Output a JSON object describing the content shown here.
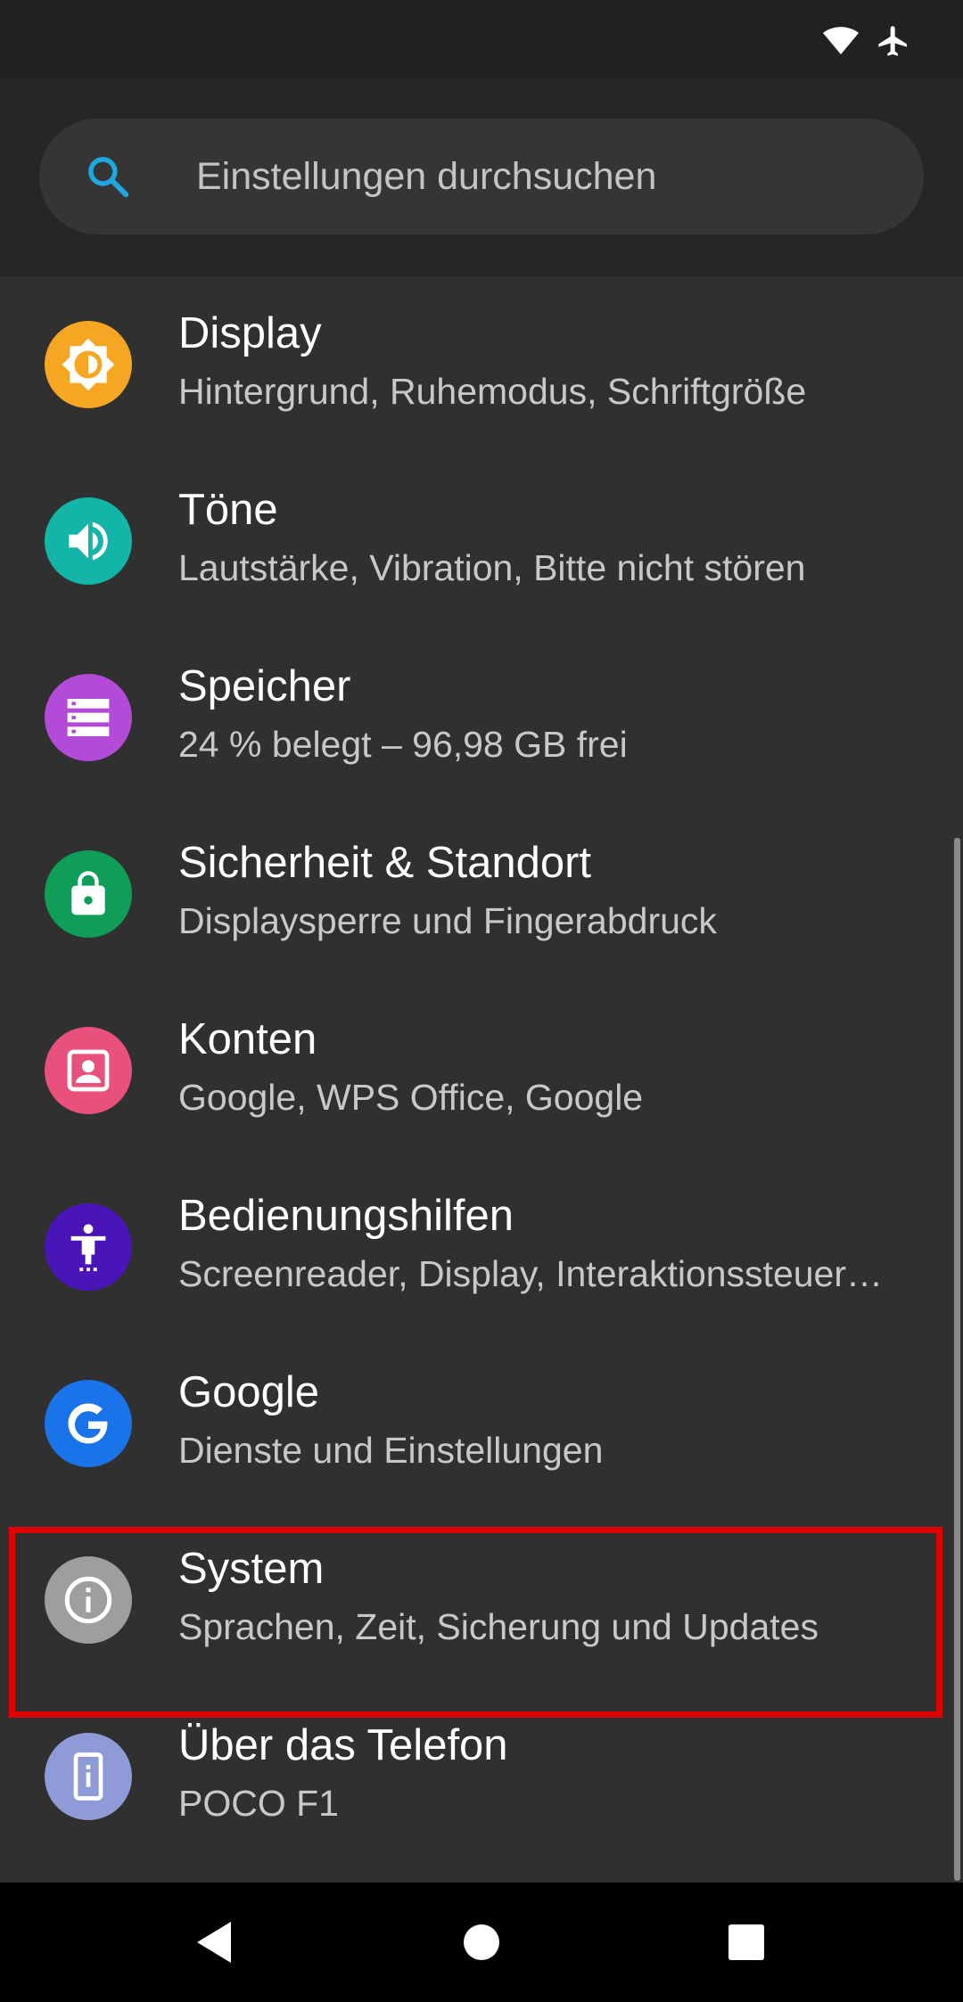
{
  "status_bar": {
    "icons": [
      "wifi-icon",
      "airplane-mode-icon"
    ]
  },
  "search": {
    "placeholder": "Einstellungen durchsuchen",
    "icon": "search-icon",
    "accent_color": "#1fa8e0"
  },
  "settings": [
    {
      "id": "display",
      "title": "Display",
      "subtitle": "Hintergrund, Ruhemodus, Schriftgröße",
      "icon": "brightness-icon",
      "color": "#f5a623"
    },
    {
      "id": "sound",
      "title": "Töne",
      "subtitle": "Lautstärke, Vibration, Bitte nicht stören",
      "icon": "volume-icon",
      "color": "#12b5a7"
    },
    {
      "id": "storage",
      "title": "Speicher",
      "subtitle": "24 % belegt – 96,98 GB frei",
      "icon": "storage-icon",
      "color": "#b34bd8"
    },
    {
      "id": "security",
      "title": "Sicherheit & Standort",
      "subtitle": "Displaysperre und Fingerabdruck",
      "icon": "lock-icon",
      "color": "#109d58"
    },
    {
      "id": "accounts",
      "title": "Konten",
      "subtitle": "Google, WPS Office, Google",
      "icon": "account-icon",
      "color": "#e9517d"
    },
    {
      "id": "accessibility",
      "title": "Bedienungshilfen",
      "subtitle": "Screenreader, Display, Interaktionssteuer…",
      "icon": "accessibility-icon",
      "color": "#4a15b8"
    },
    {
      "id": "google",
      "title": "Google",
      "subtitle": "Dienste und Einstellungen",
      "icon": "google-icon",
      "color": "#1a73e8"
    },
    {
      "id": "system",
      "title": "System",
      "subtitle": "Sprachen, Zeit, Sicherung und Updates",
      "icon": "info-icon",
      "color": "#9e9e9e"
    },
    {
      "id": "about",
      "title": "Über das Telefon",
      "subtitle": "POCO F1",
      "icon": "phone-info-icon",
      "color": "#8f9bd6"
    }
  ],
  "highlight": {
    "target": "system",
    "color": "#e00000"
  },
  "nav_bar": {
    "buttons": [
      "back-icon",
      "home-icon",
      "recents-icon"
    ]
  }
}
